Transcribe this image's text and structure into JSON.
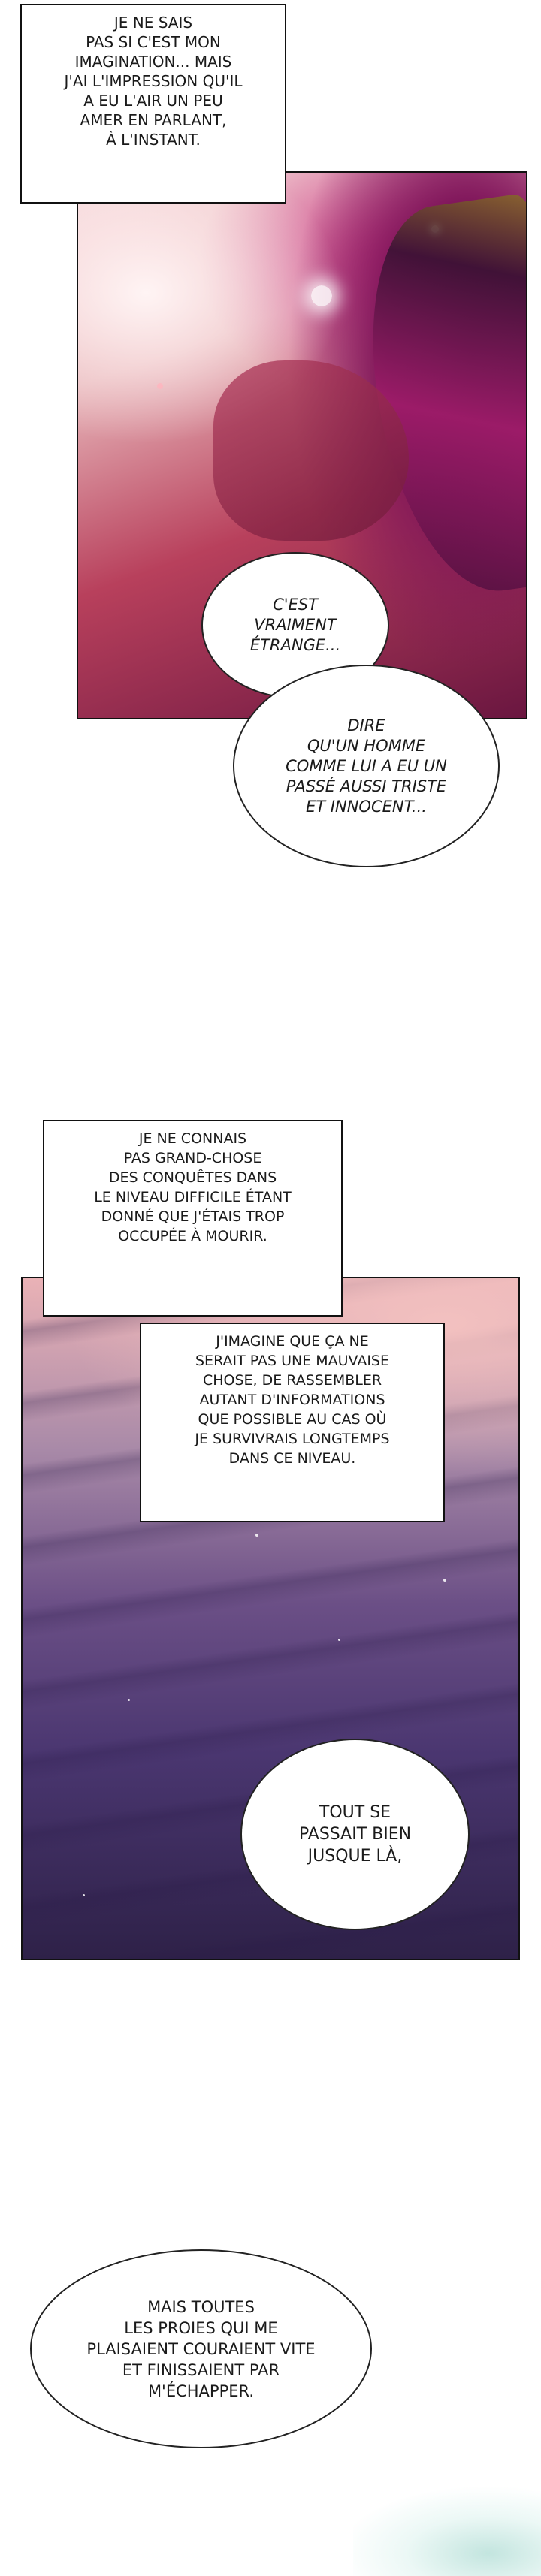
{
  "panel1": {
    "caption": "JE NE SAIS\nPAS SI C'EST MON\nIMAGINATION... MAIS\nJ'AI L'IMPRESSION QU'IL\nA EU L'AIR UN PEU\nAMER EN PARLANT,\nÀ L'INSTANT.",
    "bubble_strange": "C'EST\nVRAIMENT\nÉTRANGE...",
    "bubble_past": "DIRE\nQU'UN HOMME\nCOMME LUI A EU UN\nPASSÉ AUSSI TRISTE\nET INNOCENT..."
  },
  "panel2": {
    "caption_top": "JE NE CONNAIS\nPAS GRAND-CHOSE\nDES CONQUÊTES DANS\nLE NIVEAU DIFFICILE ÉTANT\nDONNÉ QUE J'ÉTAIS TROP\nOCCUPÉE À MOURIR.",
    "caption_second": "J'IMAGINE QUE ÇA NE\nSERAIT PAS UNE MAUVAISE\nCHOSE, DE RASSEMBLER\nAUTANT D'INFORMATIONS\nQUE POSSIBLE AU CAS OÙ\nJE SURVIVRAIS LONGTEMPS\nDANS CE NIVEAU.",
    "bubble_fine": "TOUT SE\nPASSAIT BIEN\nJUSQUE LÀ,"
  },
  "closing": {
    "bubble_prey": "MAIS TOUTES\nLES PROIES QUI ME\nPLAISAIENT COURAIENT VITE\nET FINISSAIENT PAR\nM'ÉCHAPPER."
  },
  "colors": {
    "panel1_light": "#fbe4e6",
    "panel1_mid": "#c23a5e",
    "panel1_dark": "#4a0f3a",
    "panel2_top": "#f0b4b8",
    "panel2_mid": "#6b4f86",
    "panel2_dark": "#2e2148"
  }
}
